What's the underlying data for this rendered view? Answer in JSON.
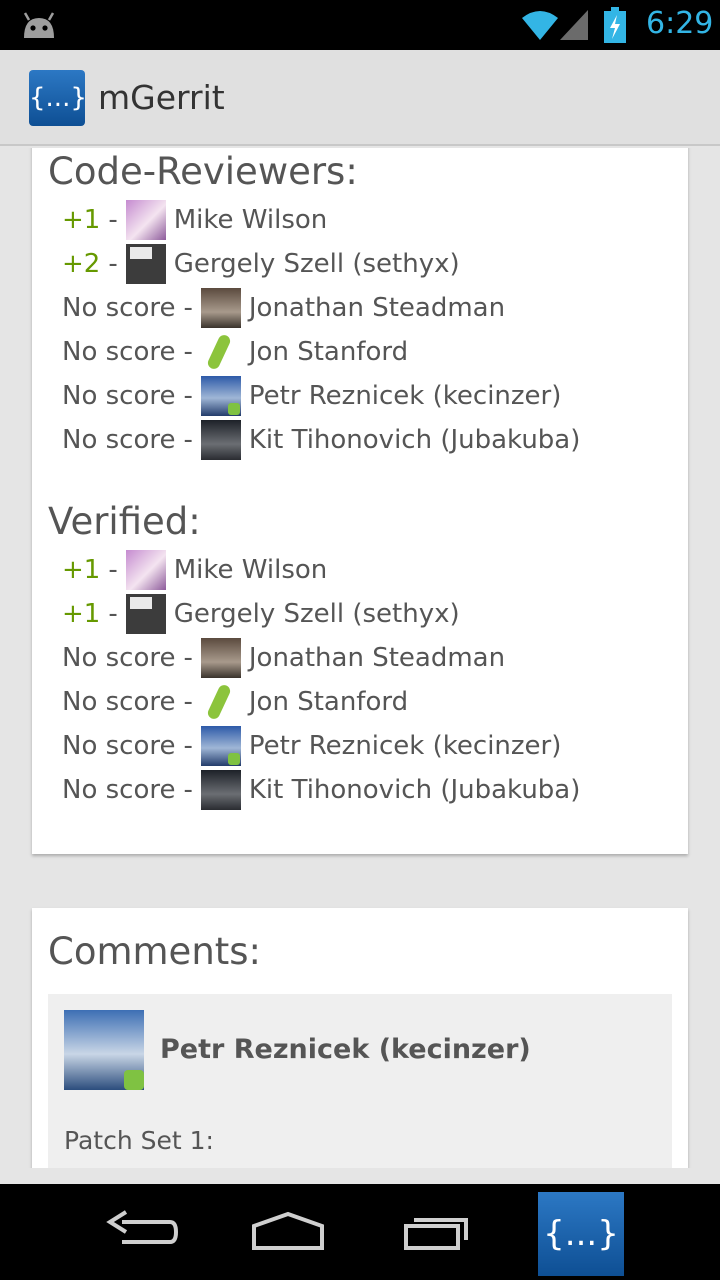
{
  "status_bar": {
    "time": "6:29"
  },
  "app_bar": {
    "icon_text": "{...}",
    "title": "mGerrit"
  },
  "reviewers": {
    "title": "Code-Reviewers:",
    "rows": [
      {
        "score": "+1",
        "name": "Mike Wilson"
      },
      {
        "score": "+2",
        "name": "Gergely Szell (sethyx)"
      },
      {
        "score": "No score",
        "name": "Jonathan Steadman"
      },
      {
        "score": "No score",
        "name": "Jon Stanford"
      },
      {
        "score": "No score",
        "name": "Petr Reznicek (kecinzer)"
      },
      {
        "score": "No score",
        "name": "Kit Tihonovich (Jubakuba)"
      }
    ]
  },
  "verified": {
    "title": "Verified:",
    "rows": [
      {
        "score": "+1",
        "name": "Mike Wilson"
      },
      {
        "score": "+1",
        "name": "Gergely Szell (sethyx)"
      },
      {
        "score": "No score",
        "name": "Jonathan Steadman"
      },
      {
        "score": "No score",
        "name": "Jon Stanford"
      },
      {
        "score": "No score",
        "name": "Petr Reznicek (kecinzer)"
      },
      {
        "score": "No score",
        "name": "Kit Tihonovich (Jubakuba)"
      }
    ]
  },
  "comments": {
    "title": "Comments:",
    "items": [
      {
        "author": "Petr Reznicek (kecinzer)",
        "text": "Patch Set 1:"
      }
    ]
  },
  "separator": "-",
  "nav_app_icon_text": "{...}",
  "colors": {
    "positive_score": "#669900",
    "text": "#555555",
    "status_accent": "#33b5e5",
    "app_blue": "#1565b0"
  }
}
